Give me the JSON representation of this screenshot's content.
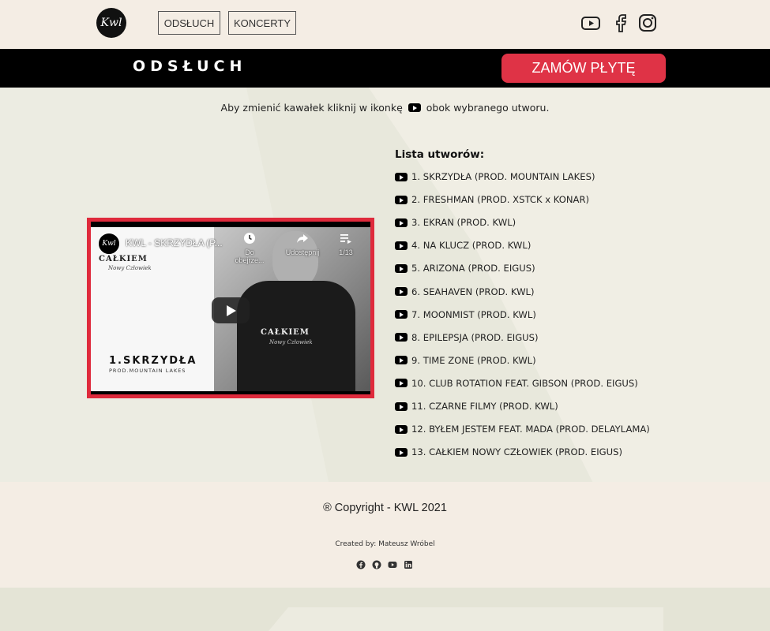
{
  "colors": {
    "accent": "#df3346",
    "band": "#000000",
    "topbar": "#f4ede4"
  },
  "nav": {
    "logo_text": "Kwl",
    "items": [
      {
        "label": "ODSŁUCH"
      },
      {
        "label": "KONCERTY"
      }
    ],
    "social": [
      "youtube-icon",
      "facebook-icon",
      "instagram-icon"
    ]
  },
  "band": {
    "title": "ODSŁUCH",
    "order_button": "ZAMÓW PŁYTĘ"
  },
  "hint": {
    "before": "Aby zmienić kawałek kliknij w ikonkę",
    "after": "obok wybranego utworu."
  },
  "video": {
    "channel_logo": "Kwl",
    "title": "KWL - SKRZYDŁA (P...",
    "watch_later": "Do obejrze...",
    "share": "Udostępnij",
    "playlist_counter": "1/13",
    "album_word": "CAŁKIEM",
    "album_sub": "Nowy Człowiek",
    "track_title": "1.SKRZYDŁA",
    "track_sub": "PROD.MOUNTAIN LAKES"
  },
  "tracklist": {
    "title": "Lista utworów:",
    "tracks": [
      "1. SKRZYDŁA (PROD. MOUNTAIN LAKES)",
      "2. FRESHMAN (PROD. XSTCK x KONAR)",
      "3. EKRAN (PROD. KWL)",
      "4. NA KLUCZ (PROD. KWL)",
      "5. ARIZONA (PROD. EIGUS)",
      "6. SEAHAVEN (PROD. KWL)",
      "7. MOONMIST (PROD. KWL)",
      "8. EPILEPSJA (PROD. EIGUS)",
      "9. TIME ZONE (PROD. KWL)",
      "10. CLUB ROTATION FEAT. GIBSON (PROD. EIGUS)",
      "11. CZARNE FILMY (PROD. KWL)",
      "12. BYŁEM JESTEM FEAT. MADA (PROD. DELAYLAMA)",
      "13. CAŁKIEM NOWY CZŁOWIEK (PROD. EIGUS)"
    ]
  },
  "footer": {
    "copyright": "® Copyright - KWL 2021",
    "creator": "Created by: Mateusz Wróbel",
    "icons": [
      "facebook-icon",
      "github-icon",
      "youtube-icon",
      "linkedin-icon"
    ]
  }
}
